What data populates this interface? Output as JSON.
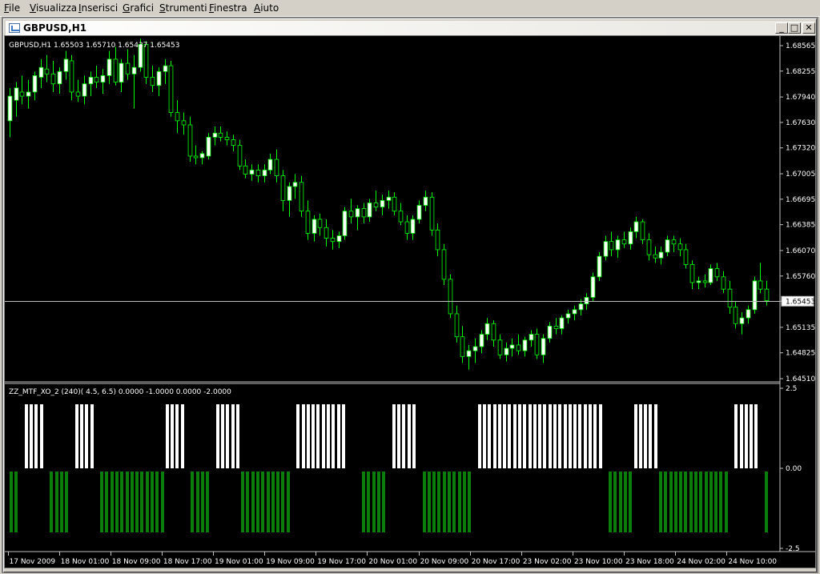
{
  "menu": [
    "File",
    "Visualizza",
    "Inserisci",
    "Grafici",
    "Strumenti",
    "Finestra",
    "Aiuto"
  ],
  "window": {
    "title": "GBPUSD,H1",
    "btn_min": "_",
    "btn_max": "□",
    "btn_close": "✕"
  },
  "colors": {
    "background": "#000000",
    "axis": "#c0c0c0",
    "bull": "#ffffff",
    "bear": "#000000",
    "wick": "#00ff00",
    "bid_line": "#c0c0c0",
    "histo_up": "#ffffff",
    "histo_down": "#0a7d0a"
  },
  "price_panel": {
    "info": "GBPUSD,H1  1.65503  1.65710  1.65437  1.65453",
    "current_price": "1.65453",
    "ticks": [
      "1.68565",
      "1.68255",
      "1.67940",
      "1.67630",
      "1.67320",
      "1.67005",
      "1.66695",
      "1.66385",
      "1.66070",
      "1.65760",
      "1.65453",
      "1.65135",
      "1.64825",
      "1.64510"
    ]
  },
  "indicator_panel": {
    "info": "ZZ_MTF_XO_2  (240)( 4.5, 6.5)  0.0000 -1.0000 0.0000 -2.0000",
    "ticks": [
      "2.5",
      "0.00",
      "-2.5"
    ],
    "ylim": [
      -2.5,
      2.5
    ]
  },
  "time_axis": [
    "17 Nov 2009",
    "18 Nov 01:00",
    "18 Nov 09:00",
    "18 Nov 17:00",
    "19 Nov 01:00",
    "19 Nov 09:00",
    "19 Nov 17:00",
    "20 Nov 01:00",
    "20 Nov 09:00",
    "20 Nov 17:00",
    "23 Nov 02:00",
    "23 Nov 10:00",
    "23 Nov 18:00",
    "24 Nov 02:00",
    "24 Nov 10:00"
  ],
  "chart_data": {
    "type": "candlestick",
    "symbol": "GBPUSD",
    "timeframe": "H1",
    "ylim": [
      1.6451,
      1.68565
    ],
    "ohlc": [
      [
        1.6765,
        1.6805,
        1.6745,
        1.6795
      ],
      [
        1.679,
        1.6812,
        1.677,
        1.6805
      ],
      [
        1.68,
        1.682,
        1.6785,
        1.6795
      ],
      [
        1.6795,
        1.6815,
        1.678,
        1.68
      ],
      [
        1.68,
        1.6825,
        1.679,
        1.682
      ],
      [
        1.6818,
        1.684,
        1.6805,
        1.683
      ],
      [
        1.6828,
        1.6845,
        1.6812,
        1.6822
      ],
      [
        1.6822,
        1.6838,
        1.68,
        1.681
      ],
      [
        1.681,
        1.683,
        1.6798,
        1.6825
      ],
      [
        1.6825,
        1.685,
        1.6815,
        1.684
      ],
      [
        1.6838,
        1.6845,
        1.679,
        1.68
      ],
      [
        1.68,
        1.6815,
        1.6788,
        1.6795
      ],
      [
        1.6795,
        1.682,
        1.6785,
        1.681
      ],
      [
        1.681,
        1.6825,
        1.6795,
        1.6818
      ],
      [
        1.6818,
        1.6832,
        1.6805,
        1.6812
      ],
      [
        1.6812,
        1.6828,
        1.6798,
        1.682
      ],
      [
        1.682,
        1.685,
        1.681,
        1.684
      ],
      [
        1.684,
        1.6855,
        1.6808,
        1.6812
      ],
      [
        1.6812,
        1.684,
        1.68,
        1.6835
      ],
      [
        1.6835,
        1.6852,
        1.6815,
        1.6822
      ],
      [
        1.6822,
        1.6845,
        1.678,
        1.683
      ],
      [
        1.683,
        1.6865,
        1.6825,
        1.6858
      ],
      [
        1.6858,
        1.6862,
        1.681,
        1.6818
      ],
      [
        1.6818,
        1.6832,
        1.68,
        1.6808
      ],
      [
        1.6808,
        1.683,
        1.6795,
        1.6825
      ],
      [
        1.6825,
        1.684,
        1.681,
        1.6832
      ],
      [
        1.6832,
        1.6838,
        1.677,
        1.6775
      ],
      [
        1.6775,
        1.679,
        1.675,
        1.6765
      ],
      [
        1.6765,
        1.6775,
        1.6748,
        1.676
      ],
      [
        1.676,
        1.677,
        1.6715,
        1.6722
      ],
      [
        1.6722,
        1.6735,
        1.6712,
        1.672
      ],
      [
        1.672,
        1.6728,
        1.6712,
        1.6725
      ],
      [
        1.6722,
        1.675,
        1.6718,
        1.6745
      ],
      [
        1.6745,
        1.6758,
        1.6735,
        1.675
      ],
      [
        1.675,
        1.6758,
        1.674,
        1.6745
      ],
      [
        1.6745,
        1.6752,
        1.6735,
        1.6742
      ],
      [
        1.6742,
        1.6748,
        1.6728,
        1.6735
      ],
      [
        1.6735,
        1.6742,
        1.6705,
        1.671
      ],
      [
        1.671,
        1.6718,
        1.6695,
        1.67
      ],
      [
        1.67,
        1.6712,
        1.6692,
        1.6705
      ],
      [
        1.6705,
        1.6712,
        1.669,
        1.6698
      ],
      [
        1.6698,
        1.6712,
        1.669,
        1.6705
      ],
      [
        1.6705,
        1.6725,
        1.67,
        1.6718
      ],
      [
        1.6718,
        1.673,
        1.669,
        1.6698
      ],
      [
        1.6698,
        1.6705,
        1.6655,
        1.6668
      ],
      [
        1.6668,
        1.669,
        1.6648,
        1.6685
      ],
      [
        1.6685,
        1.67,
        1.667,
        1.669
      ],
      [
        1.669,
        1.6698,
        1.6648,
        1.6655
      ],
      [
        1.6655,
        1.6668,
        1.662,
        1.6628
      ],
      [
        1.6628,
        1.665,
        1.6618,
        1.6645
      ],
      [
        1.6645,
        1.6652,
        1.6625,
        1.6635
      ],
      [
        1.6635,
        1.6645,
        1.6612,
        1.6622
      ],
      [
        1.6622,
        1.6632,
        1.6608,
        1.6618
      ],
      [
        1.6618,
        1.663,
        1.661,
        1.6625
      ],
      [
        1.6625,
        1.666,
        1.662,
        1.6655
      ],
      [
        1.6655,
        1.667,
        1.664,
        1.6648
      ],
      [
        1.6648,
        1.6662,
        1.6632,
        1.6658
      ],
      [
        1.6658,
        1.6665,
        1.664,
        1.6648
      ],
      [
        1.6648,
        1.667,
        1.6642,
        1.6665
      ],
      [
        1.6665,
        1.668,
        1.6655,
        1.666
      ],
      [
        1.666,
        1.6675,
        1.665,
        1.6668
      ],
      [
        1.6668,
        1.668,
        1.6658,
        1.6672
      ],
      [
        1.6672,
        1.6678,
        1.665,
        1.6655
      ],
      [
        1.6655,
        1.6665,
        1.6638,
        1.6642
      ],
      [
        1.6642,
        1.665,
        1.662,
        1.6628
      ],
      [
        1.6628,
        1.665,
        1.662,
        1.6645
      ],
      [
        1.6645,
        1.6668,
        1.664,
        1.6662
      ],
      [
        1.6662,
        1.668,
        1.6655,
        1.6672
      ],
      [
        1.6672,
        1.6678,
        1.6625,
        1.6632
      ],
      [
        1.6632,
        1.664,
        1.66,
        1.6608
      ],
      [
        1.6608,
        1.6615,
        1.6565,
        1.6572
      ],
      [
        1.6572,
        1.6578,
        1.6525,
        1.653
      ],
      [
        1.653,
        1.654,
        1.6495,
        1.6502
      ],
      [
        1.6502,
        1.6515,
        1.647,
        1.6478
      ],
      [
        1.6478,
        1.6492,
        1.6462,
        1.6485
      ],
      [
        1.6485,
        1.65,
        1.647,
        1.649
      ],
      [
        1.649,
        1.651,
        1.6482,
        1.6505
      ],
      [
        1.6505,
        1.6525,
        1.6498,
        1.6518
      ],
      [
        1.6518,
        1.6522,
        1.649,
        1.6498
      ],
      [
        1.6498,
        1.6505,
        1.6475,
        1.648
      ],
      [
        1.648,
        1.6495,
        1.6472,
        1.6488
      ],
      [
        1.6488,
        1.65,
        1.6478,
        1.6492
      ],
      [
        1.6492,
        1.6505,
        1.648,
        1.6485
      ],
      [
        1.6485,
        1.6502,
        1.6478,
        1.6498
      ],
      [
        1.6498,
        1.651,
        1.649,
        1.6505
      ],
      [
        1.6505,
        1.6512,
        1.6475,
        1.648
      ],
      [
        1.648,
        1.6505,
        1.647,
        1.65
      ],
      [
        1.65,
        1.652,
        1.6495,
        1.6515
      ],
      [
        1.6515,
        1.6525,
        1.6505,
        1.6512
      ],
      [
        1.6512,
        1.6528,
        1.6505,
        1.6525
      ],
      [
        1.6525,
        1.6535,
        1.6518,
        1.653
      ],
      [
        1.653,
        1.654,
        1.6522,
        1.6535
      ],
      [
        1.6535,
        1.6548,
        1.6528,
        1.6542
      ],
      [
        1.6542,
        1.6555,
        1.6535,
        1.655
      ],
      [
        1.655,
        1.658,
        1.6545,
        1.6575
      ],
      [
        1.6575,
        1.6605,
        1.657,
        1.66
      ],
      [
        1.66,
        1.6625,
        1.6595,
        1.6618
      ],
      [
        1.6618,
        1.663,
        1.66,
        1.6608
      ],
      [
        1.6608,
        1.6625,
        1.6598,
        1.662
      ],
      [
        1.662,
        1.663,
        1.661,
        1.6615
      ],
      [
        1.6615,
        1.6635,
        1.6608,
        1.663
      ],
      [
        1.663,
        1.6648,
        1.6622,
        1.6642
      ],
      [
        1.6642,
        1.6645,
        1.6615,
        1.662
      ],
      [
        1.662,
        1.6628,
        1.6595,
        1.6602
      ],
      [
        1.6602,
        1.6612,
        1.6592,
        1.6598
      ],
      [
        1.6598,
        1.6612,
        1.659,
        1.6605
      ],
      [
        1.6605,
        1.6625,
        1.66,
        1.662
      ],
      [
        1.662,
        1.6625,
        1.6605,
        1.6615
      ],
      [
        1.6615,
        1.6622,
        1.66,
        1.6608
      ],
      [
        1.6608,
        1.6615,
        1.6585,
        1.659
      ],
      [
        1.659,
        1.6595,
        1.656,
        1.6568
      ],
      [
        1.6568,
        1.6575,
        1.656,
        1.657
      ],
      [
        1.657,
        1.6578,
        1.6562,
        1.6568
      ],
      [
        1.6568,
        1.659,
        1.6565,
        1.6585
      ],
      [
        1.6585,
        1.6592,
        1.657,
        1.6575
      ],
      [
        1.6575,
        1.6582,
        1.6555,
        1.656
      ],
      [
        1.656,
        1.657,
        1.653,
        1.6538
      ],
      [
        1.6538,
        1.6545,
        1.6512,
        1.6518
      ],
      [
        1.6518,
        1.6532,
        1.6505,
        1.6525
      ],
      [
        1.6525,
        1.654,
        1.6518,
        1.6535
      ],
      [
        1.6535,
        1.6575,
        1.653,
        1.657
      ],
      [
        1.657,
        1.6592,
        1.6555,
        1.656
      ],
      [
        1.656,
        1.657,
        1.654,
        1.6546
      ]
    ],
    "indicator": {
      "name": "ZZ_MTF_XO_2",
      "ylim": [
        -2.5,
        2.5
      ],
      "values": [
        -2,
        -2,
        0,
        2,
        2,
        2,
        2,
        0,
        -2,
        -2,
        -2,
        -2,
        0,
        2,
        2,
        2,
        2,
        0,
        -2,
        -2,
        -2,
        -2,
        -2,
        -2,
        -2,
        -2,
        -2,
        -2,
        -2,
        -2,
        -2,
        2,
        2,
        2,
        2,
        0,
        -2,
        -2,
        -2,
        -2,
        0,
        2,
        2,
        2,
        2,
        2,
        -2,
        -2,
        -2,
        -2,
        -2,
        -2,
        -2,
        -2,
        -2,
        -2,
        0,
        2,
        2,
        2,
        2,
        2,
        2,
        2,
        2,
        2,
        2,
        0,
        0,
        0,
        -2,
        -2,
        -2,
        -2,
        -2,
        0,
        2,
        2,
        2,
        2,
        2,
        0,
        -2,
        -2,
        -2,
        -2,
        -2,
        -2,
        -2,
        -2,
        -2,
        -2,
        0,
        2,
        2,
        2,
        2,
        2,
        2,
        2,
        2,
        2,
        2,
        2,
        2,
        2,
        2,
        2,
        2,
        2,
        2,
        2,
        2,
        2,
        2,
        2,
        2,
        2,
        0,
        -2,
        -2,
        -2,
        -2,
        -2,
        2,
        2,
        2,
        2,
        2,
        -2,
        -2,
        -2,
        -2,
        -2,
        -2,
        -2,
        -2,
        -2,
        -2,
        -2,
        -2,
        -2,
        -2,
        0,
        2,
        2,
        2,
        2,
        2,
        0,
        -2
      ]
    }
  }
}
